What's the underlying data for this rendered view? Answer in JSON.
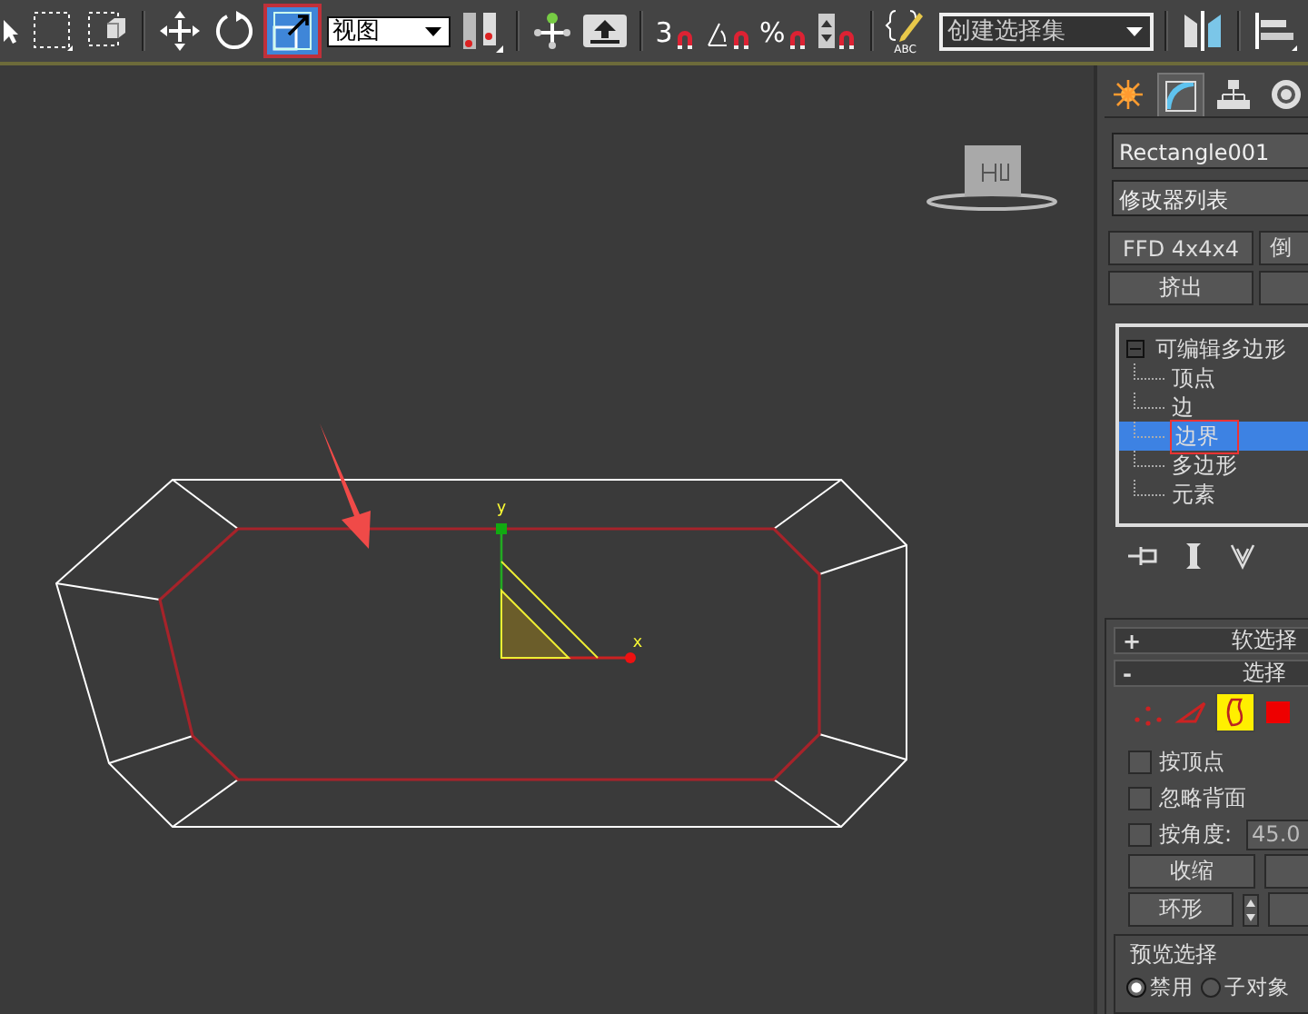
{
  "toolbar": {
    "tools": [
      {
        "kind": "select",
        "selected": false
      },
      {
        "kind": "rect-region",
        "selected": false
      },
      {
        "kind": "window-crossing",
        "selected": false
      },
      {
        "kind": "move",
        "selected": false
      },
      {
        "kind": "rotate",
        "selected": false
      },
      {
        "kind": "scale",
        "selected": true
      }
    ],
    "coordinate_dropdown": {
      "value": "视图"
    },
    "snaps": [
      {
        "kind": "three",
        "label": "3"
      },
      {
        "kind": "angle"
      },
      {
        "kind": "percent",
        "label": "%"
      },
      {
        "kind": "spinner"
      }
    ],
    "named_selection_label": "ABC",
    "named_selection_dropdown": {
      "value": "创建选择集"
    }
  },
  "viewport": {
    "axis_labels": [
      {
        "kind": "y",
        "text": "y"
      },
      {
        "kind": "x",
        "text": "x"
      }
    ]
  },
  "command_panel": {
    "tabs": [
      {
        "kind": "create",
        "selected": false
      },
      {
        "kind": "modify",
        "selected": true
      },
      {
        "kind": "hierarchy",
        "selected": false
      },
      {
        "kind": "motion",
        "selected": false
      }
    ],
    "object_name": "Rectangle001",
    "modifier_list": "修改器列表",
    "modifier_buttons": [
      "FFD 4x4x4",
      "倒",
      "挤出"
    ],
    "modifier_stack": [
      {
        "label": "可编辑多边形",
        "expanded": true,
        "selected": false,
        "children": [
          {
            "label": "顶点",
            "selected": false
          },
          {
            "label": "边",
            "selected": false
          },
          {
            "label": "边界",
            "selected": true
          },
          {
            "label": "多边形",
            "selected": false
          },
          {
            "label": "元素",
            "selected": false
          }
        ]
      }
    ],
    "rollouts": [
      {
        "toggle": "+",
        "title": "软选择"
      },
      {
        "toggle": "-",
        "title": "选择"
      }
    ],
    "selection": {
      "levels": [
        {
          "kind": "vertex",
          "selected": false
        },
        {
          "kind": "edge",
          "selected": false
        },
        {
          "kind": "border",
          "selected": true
        },
        {
          "kind": "polygon",
          "selected": false
        }
      ],
      "checkboxes": [
        {
          "label": "按顶点",
          "checked": false
        },
        {
          "label": "忽略背面",
          "checked": false
        },
        {
          "label": "按角度:",
          "checked": false
        }
      ],
      "angle_value": "45.0",
      "buttons": [
        "收缩",
        "环形"
      ],
      "preview": {
        "title": "预览选择",
        "options": [
          {
            "label": "禁用",
            "selected": true
          },
          {
            "label": "子对象",
            "selected": false
          }
        ]
      }
    }
  }
}
